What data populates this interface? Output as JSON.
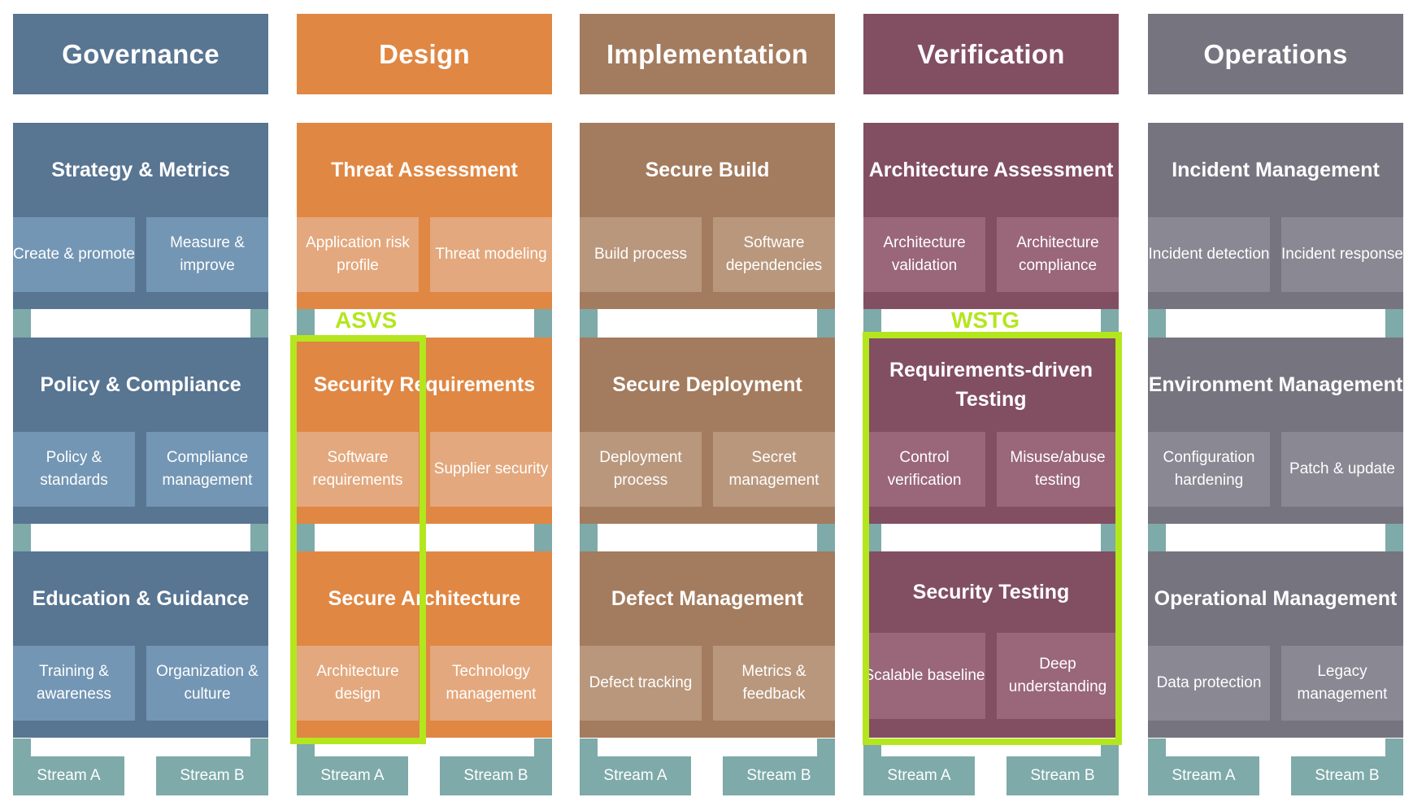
{
  "colors": {
    "teal": "#7eaaa9",
    "highlight": "#b4e61e"
  },
  "functions": [
    {
      "name": "Governance",
      "color": "#587592",
      "sub_color": "#7396b4",
      "practices": [
        {
          "title": "Strategy & Metrics",
          "a": "Create & promote",
          "b": "Measure & improve"
        },
        {
          "title": "Policy & Compliance",
          "a": "Policy & standards",
          "b": "Compliance management"
        },
        {
          "title": "Education & Guidance",
          "a": "Training & awareness",
          "b": "Organization & culture"
        }
      ],
      "streams": {
        "a": "Stream A",
        "b": "Stream B"
      }
    },
    {
      "name": "Design",
      "color": "#e08743",
      "sub_color": "#e3a87d",
      "practices": [
        {
          "title": "Threat Assessment",
          "a": "Application risk profile",
          "b": "Threat modeling"
        },
        {
          "title": "Security Requirements",
          "a": "Software requirements",
          "b": "Supplier security"
        },
        {
          "title": "Secure Architecture",
          "a": "Architecture design",
          "b": "Technology management"
        }
      ],
      "streams": {
        "a": "Stream A",
        "b": "Stream B"
      }
    },
    {
      "name": "Implementation",
      "color": "#a37b5e",
      "sub_color": "#b9977c",
      "practices": [
        {
          "title": "Secure Build",
          "a": "Build process",
          "b": "Software dependencies"
        },
        {
          "title": "Secure Deployment",
          "a": "Deployment process",
          "b": "Secret management"
        },
        {
          "title": "Defect Management",
          "a": "Defect tracking",
          "b": "Metrics & feedback"
        }
      ],
      "streams": {
        "a": "Stream A",
        "b": "Stream B"
      }
    },
    {
      "name": "Verification",
      "color": "#824e62",
      "sub_color": "#9a667a",
      "practices": [
        {
          "title": "Architecture Assessment",
          "a": "Architecture validation",
          "b": "Architecture compliance"
        },
        {
          "title": "Requirements-driven Testing",
          "a": "Control verification",
          "b": "Misuse/abuse testing"
        },
        {
          "title": "Security Testing",
          "a": "Scalable baseline",
          "b": "Deep understanding"
        }
      ],
      "streams": {
        "a": "Stream A",
        "b": "Stream B"
      }
    },
    {
      "name": "Operations",
      "color": "#75747f",
      "sub_color": "#898893",
      "practices": [
        {
          "title": "Incident Management",
          "a": "Incident detection",
          "b": "Incident response"
        },
        {
          "title": "Environment Management",
          "a": "Configuration hardening",
          "b": "Patch & update"
        },
        {
          "title": "Operational Management",
          "a": "Data protection",
          "b": "Legacy management"
        }
      ],
      "streams": {
        "a": "Stream A",
        "b": "Stream B"
      }
    }
  ],
  "annotations": [
    {
      "label": "ASVS",
      "covers": "Design / Stream A of Security Requirements and Secure Architecture"
    },
    {
      "label": "WSTG",
      "covers": "Verification / Requirements-driven Testing and Security Testing"
    }
  ]
}
